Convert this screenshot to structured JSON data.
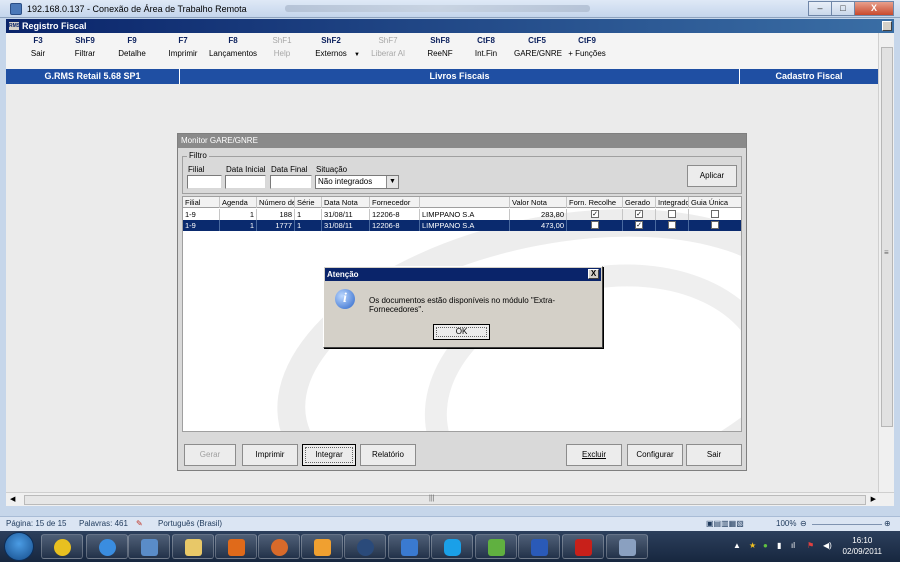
{
  "rdp": {
    "title": "192.168.0.137 - Conexão de Área de Trabalho Remota",
    "minimize": "–",
    "restore": "□",
    "close": "X"
  },
  "app": {
    "title": "Registro Fiscal",
    "logo": "RMS"
  },
  "toolbar": [
    {
      "key": "F3",
      "label": "Sair",
      "enabled": true
    },
    {
      "key": "ShF9",
      "label": "Filtrar",
      "enabled": true
    },
    {
      "key": "F9",
      "label": "Detalhe",
      "enabled": true
    },
    {
      "key": "F7",
      "label": "Imprimir",
      "enabled": true
    },
    {
      "key": "F8",
      "label": "Lançamentos",
      "enabled": true
    },
    {
      "key": "ShF1",
      "label": "Help",
      "enabled": false
    },
    {
      "key": "ShF2",
      "label": "Externos",
      "enabled": true
    },
    {
      "key": "ShF7",
      "label": "Liberar Al",
      "enabled": false
    },
    {
      "key": "ShF8",
      "label": "ReeNF",
      "enabled": true
    },
    {
      "key": "CtF8",
      "label": "Int.Fin",
      "enabled": true
    },
    {
      "key": "CtF5",
      "label": "GARE/GNRE",
      "enabled": true
    },
    {
      "key": "CtF9",
      "label": "+ Funções",
      "enabled": true
    }
  ],
  "header_bar": {
    "left": "G.RMS Retail 5.68 SP1",
    "center": "Livros Fiscais",
    "right": "Cadastro Fiscal"
  },
  "monitor": {
    "title": "Monitor GARE/GNRE",
    "filter_legend": "Filtro",
    "labels": {
      "filial": "Filial",
      "data_inicial": "Data Inicial",
      "data_final": "Data Final",
      "situacao": "Situação"
    },
    "values": {
      "filial": "",
      "data_inicial": "",
      "data_final": ""
    },
    "situacao_selected": "Não integrados",
    "apply_button": "Aplicar",
    "columns": [
      "Filial",
      "Agenda",
      "Número de",
      "Série",
      "Data Nota",
      "Fornecedor",
      "",
      "Valor Nota",
      "Forn. Recolhe",
      "Gerado",
      "Integrado",
      "Guia Única"
    ],
    "rows": [
      {
        "filial": "1-9",
        "agenda": "1",
        "numero": "188",
        "serie": "1",
        "data_nota": "31/08/11",
        "fornecedor_cod": "12206-8",
        "fornecedor_nome": "LIMPPANO S.A",
        "valor": "283,80",
        "forn_recolhe": true,
        "gerado": true,
        "integrado": false,
        "guia_unica": false,
        "selected": false
      },
      {
        "filial": "1-9",
        "agenda": "1",
        "numero": "1777",
        "serie": "1",
        "data_nota": "31/08/11",
        "fornecedor_cod": "12206-8",
        "fornecedor_nome": "LIMPPANO S.A",
        "valor": "473,00",
        "forn_recolhe": false,
        "gerado": true,
        "integrado": false,
        "guia_unica": false,
        "selected": true
      }
    ],
    "bottom_buttons": {
      "gerar": "Gerar",
      "imprimir": "Imprimir",
      "integrar": "Integrar",
      "relatorio": "Relatório",
      "excluir": "Excluir",
      "configurar": "Configurar",
      "sair": "Sair"
    }
  },
  "dialog": {
    "title": "Atenção",
    "close": "X",
    "icon": "info-icon",
    "message": "Os documentos estão disponíveis no módulo \"Extra-Fornecedores\".",
    "ok": "OK"
  },
  "statusbar": {
    "page": "Página: 15 de 15",
    "words": "Palavras: 461",
    "language": "Português (Brasil)",
    "zoom": "100%"
  },
  "taskbar": {
    "time": "16:10",
    "date": "02/09/2011",
    "apps": [
      "ie-icon",
      "explorer-icon",
      "remote-desktop-icon",
      "folder-icon",
      "media-icon",
      "firefox-icon",
      "mail-icon",
      "hp-icon",
      "msn-icon",
      "skype-icon",
      "network-icon",
      "word-icon",
      "acrobat-icon",
      "calculator-icon"
    ]
  },
  "colors": {
    "accent": "#1f4fa3",
    "selection": "#0a2a6e",
    "dialog_title": "#0a246a"
  }
}
